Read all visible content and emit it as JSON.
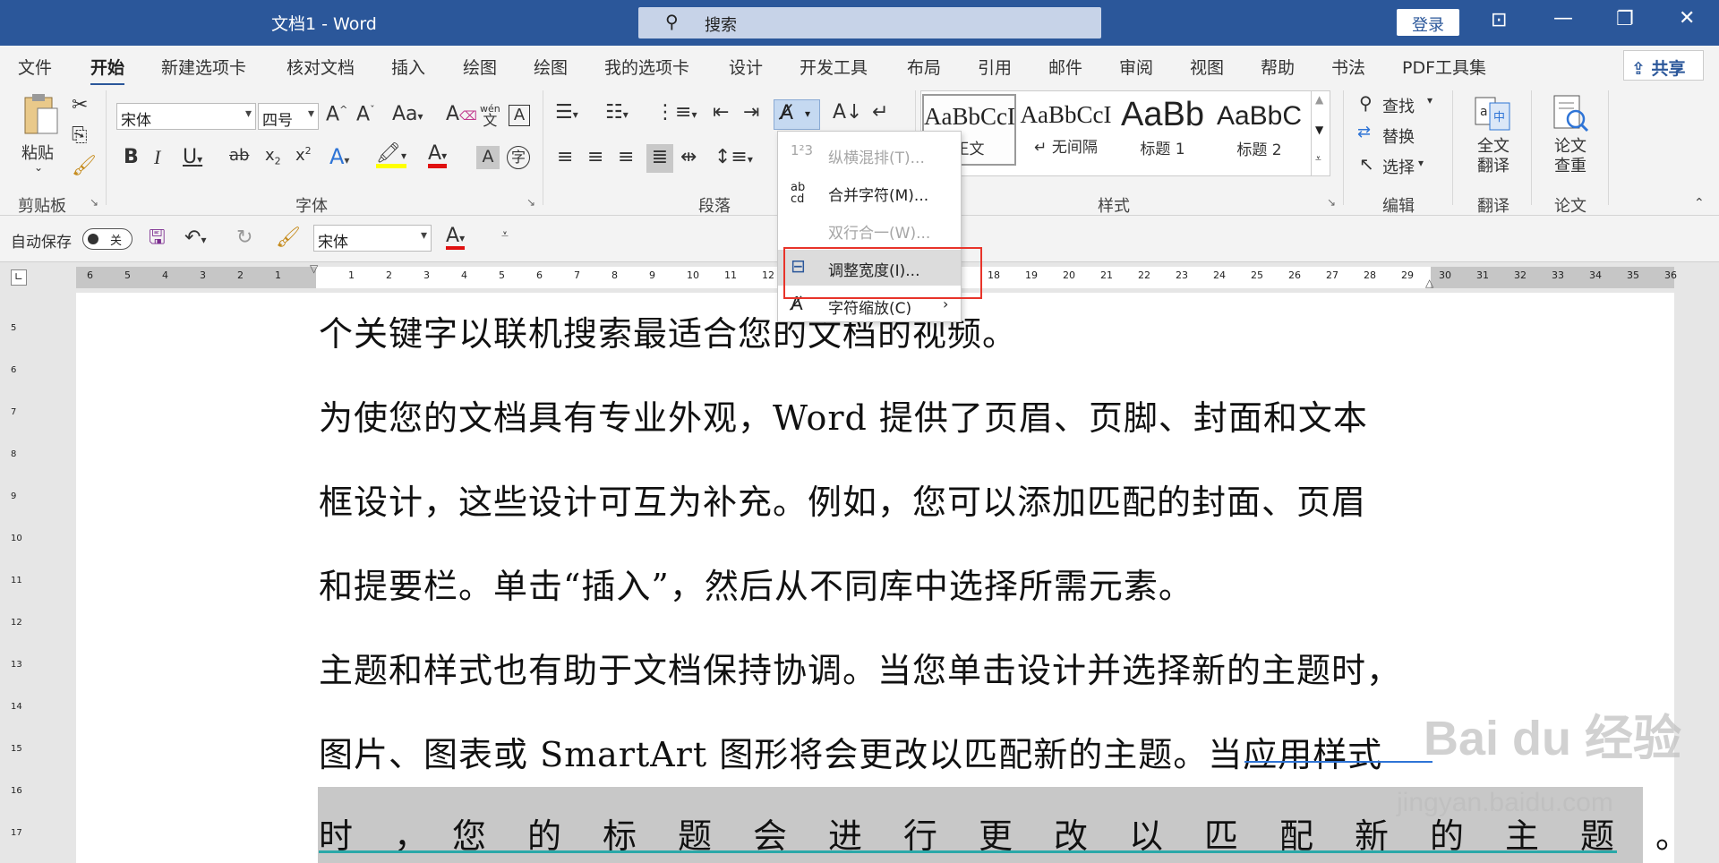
{
  "window": {
    "title": "文档1  -  Word",
    "search_placeholder": "搜索",
    "login_label": "登录",
    "controls": {
      "minimize": "—",
      "maximize": "❐",
      "close": "✕",
      "ribbon_display": "⊡"
    }
  },
  "tabs": [
    "文件",
    "开始",
    "新建选项卡",
    "核对文档",
    "插入",
    "绘图",
    "绘图",
    "我的选项卡",
    "设计",
    "开发工具",
    "布局",
    "引用",
    "邮件",
    "审阅",
    "视图",
    "帮助",
    "书法",
    "PDF工具集"
  ],
  "active_tab": "开始",
  "share_label": "共享",
  "ribbon": {
    "clipboard": {
      "label": "剪贴板",
      "paste": "粘贴"
    },
    "font": {
      "label": "字体",
      "family": "宋体",
      "size": "四号",
      "wen": "wén"
    },
    "paragraph": {
      "label": "段落"
    },
    "styles": {
      "label": "样式",
      "items": [
        {
          "sample": "AaBbCcI",
          "name": "正文"
        },
        {
          "sample": "AaBbCcI",
          "name": "↵ 无间隔"
        },
        {
          "sample": "AaBb",
          "name": "标题 1"
        },
        {
          "sample": "AaBbC",
          "name": "标题 2"
        }
      ]
    },
    "editing": {
      "label": "编辑",
      "find": "查找",
      "replace": "替换",
      "select": "选择"
    },
    "translate": {
      "label": "翻译",
      "button": "全文\n翻译"
    },
    "paper": {
      "label": "论文",
      "button": "论文\n查重"
    }
  },
  "qat": {
    "autosave": "自动保存",
    "toggle": "关",
    "font": "宋体"
  },
  "dropdown": {
    "items": [
      {
        "label": "纵横混排(T)...",
        "disabled": true,
        "icon": "123"
      },
      {
        "label": "合并字符(M)...",
        "disabled": false,
        "icon": "ab cd"
      },
      {
        "label": "双行合一(W)...",
        "disabled": true,
        "icon": ""
      },
      {
        "label": "调整宽度(I)...",
        "disabled": false,
        "icon": "width-icon",
        "highlighted": true
      },
      {
        "label": "字符缩放(C)",
        "disabled": false,
        "icon": "scale-icon",
        "submenu": true
      }
    ],
    "highlight_color": "#e8342a"
  },
  "ruler": {
    "left_numbers": [
      "6",
      "5",
      "4",
      "3",
      "2",
      "1"
    ],
    "right_numbers": [
      "1",
      "2",
      "3",
      "4",
      "5",
      "6",
      "7",
      "8",
      "9",
      "10",
      "11",
      "12",
      "",
      "",
      "",
      "",
      "",
      "18",
      "19",
      "20",
      "21",
      "22",
      "23",
      "24",
      "25",
      "26",
      "27",
      "28",
      "29",
      "30",
      "31",
      "32",
      "33",
      "34",
      "35",
      "36"
    ],
    "vertical_numbers": [
      "5",
      "6",
      "7",
      "8",
      "9",
      "10",
      "11",
      "12",
      "13",
      "14",
      "15",
      "16",
      "17"
    ]
  },
  "document": {
    "lines": [
      "个关键字以联机搜索最适合您的文档的视频。",
      "为使您的文档具有专业外观，Word 提供了页眉、页脚、封面和文本",
      "框设计，这些设计可互为补充。例如，您可以添加匹配的封面、页眉",
      "和提要栏。单击“插入”，然后从不同库中选择所需元素。",
      "主题和样式也有助于文档保持协调。当您单击设计并选择新的主题时，",
      "图片、图表或 SmartArt 图形将会更改以匹配新的主题。当应用样式",
      "时　，　您　的　标　题　会　进　行　更　改　以　匹　配　新　的　主　题　。"
    ]
  },
  "watermark": {
    "text": "Bai du 经验",
    "url": "jingyan.baidu.com"
  },
  "colors": {
    "accent": "#2b579a",
    "highlight_box": "#e8342a",
    "selection": "#c8c8c8"
  }
}
